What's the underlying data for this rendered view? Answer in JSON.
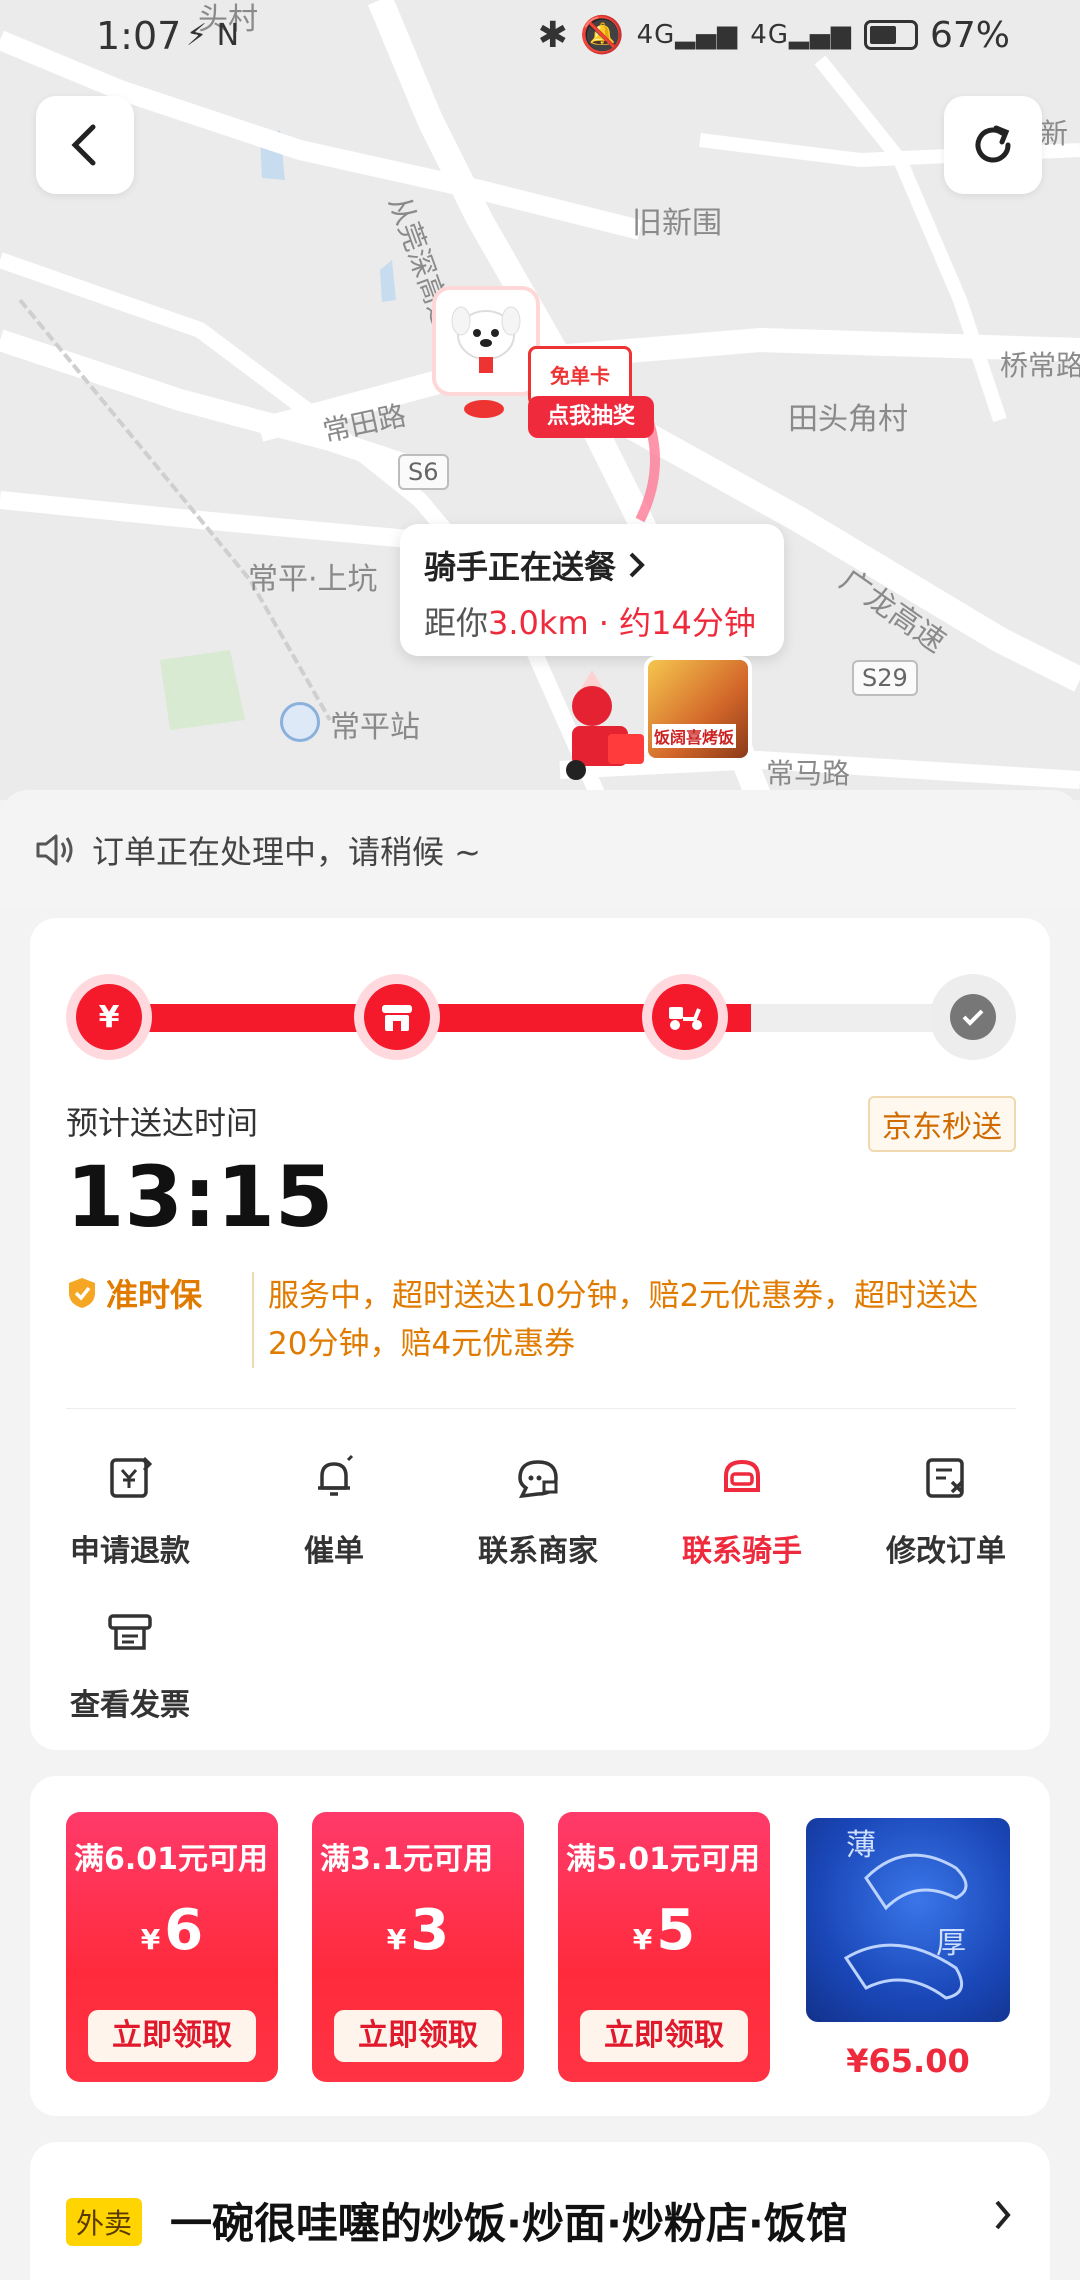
{
  "status_bar": {
    "time": "1:07",
    "left_icons": "⚡ N",
    "net1": "4G",
    "net2": "4G",
    "battery": "67%"
  },
  "map": {
    "labels": [
      "头村",
      "旧新围",
      "从莞深高速",
      "常田路",
      "桥常路",
      "田头角村",
      "常平·上坑",
      "广龙高速",
      "常平站",
      "常马路",
      "新"
    ],
    "road_tags": [
      "S6",
      "S29"
    ],
    "free_card_badge": "免单卡",
    "lottery_badge": "点我抽奖",
    "food_thumb_text": "饭阔喜烤饭",
    "popup": {
      "title": "骑手正在送餐",
      "distance_prefix": "距你",
      "distance_value": "3.0km · 约14分钟"
    }
  },
  "notice": {
    "text": "订单正在处理中，请稍候 ~"
  },
  "order": {
    "progress_fraction": 0.75,
    "eta_label": "预计送达时间",
    "eta_time": "13:15",
    "express_tag": "京东秒送",
    "ontime_title": "准时保",
    "ontime_desc": "服务中，超时送达10分钟，赔2元优惠券，超时送达20分钟，赔4元优惠券",
    "actions": [
      {
        "label": "申请退款",
        "icon": "refund-icon"
      },
      {
        "label": "催单",
        "icon": "bell-icon"
      },
      {
        "label": "联系商家",
        "icon": "chat-icon"
      },
      {
        "label": "联系骑手",
        "icon": "rider-icon",
        "active": true
      },
      {
        "label": "修改订单",
        "icon": "edit-order-icon"
      },
      {
        "label": "查看发票",
        "icon": "invoice-icon"
      }
    ]
  },
  "coupons": [
    {
      "condition": "满6.01元可用",
      "currency": "¥",
      "amount": "6",
      "button": "立即领取"
    },
    {
      "condition": "满3.1元可用",
      "currency": "¥",
      "amount": "3",
      "button": "立即领取"
    },
    {
      "condition": "满5.01元可用",
      "currency": "¥",
      "amount": "5",
      "button": "立即领取"
    }
  ],
  "product": {
    "price": "¥65.00",
    "img_text_top": "薄",
    "img_text_bottom": "厚"
  },
  "shop": {
    "tag": "外卖",
    "name": "一碗很哇噻的炒饭·炒面·炒粉店·饭馆"
  },
  "colors": {
    "accent": "#ef2a3c",
    "orange": "#e07b00",
    "track": "#eeeeee"
  }
}
